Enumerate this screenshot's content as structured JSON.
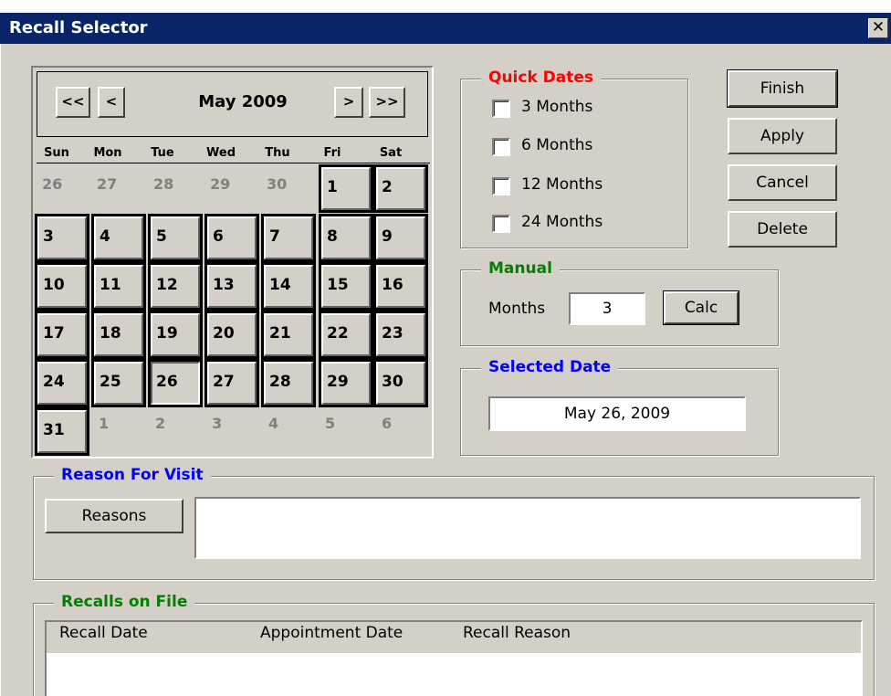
{
  "window": {
    "title": "Recall Selector",
    "close_glyph": "✕"
  },
  "calendar": {
    "prev_year": "<<",
    "prev_month": "<",
    "month_label": "May 2009",
    "next_month": ">",
    "next_year": ">>",
    "weekdays": [
      "Sun",
      "Mon",
      "Tue",
      "Wed",
      "Thu",
      "Fri",
      "Sat"
    ],
    "prev_days": [
      "26",
      "27",
      "28",
      "29",
      "30"
    ],
    "days": [
      "1",
      "2",
      "3",
      "4",
      "5",
      "6",
      "7",
      "8",
      "9",
      "10",
      "11",
      "12",
      "13",
      "14",
      "15",
      "16",
      "17",
      "18",
      "19",
      "20",
      "21",
      "22",
      "23",
      "24",
      "25",
      "26",
      "27",
      "28",
      "29",
      "30",
      "31"
    ],
    "next_days": [
      "1",
      "2",
      "3",
      "4",
      "5",
      "6"
    ],
    "selected_day": "26"
  },
  "quick_dates": {
    "title": "Quick Dates",
    "title_color": "#ff0000",
    "options": [
      "3 Months",
      "6 Months",
      "12 Months",
      "24 Months"
    ]
  },
  "manual": {
    "title": "Manual",
    "title_color": "#008000",
    "months_label": "Months",
    "months_value": "3",
    "calc_label": "Calc"
  },
  "selected_date": {
    "title": "Selected Date",
    "title_color": "#0000ff",
    "value": "May 26, 2009"
  },
  "actions": {
    "finish": "Finish",
    "apply": "Apply",
    "cancel": "Cancel",
    "delete": "Delete"
  },
  "reason": {
    "title": "Reason For Visit",
    "title_color": "#0000ff",
    "button": "Reasons",
    "text": ""
  },
  "recalls": {
    "title": "Recalls on File",
    "title_color": "#008000",
    "columns": [
      "Recall Date",
      "Appointment Date",
      "Recall Reason"
    ]
  }
}
